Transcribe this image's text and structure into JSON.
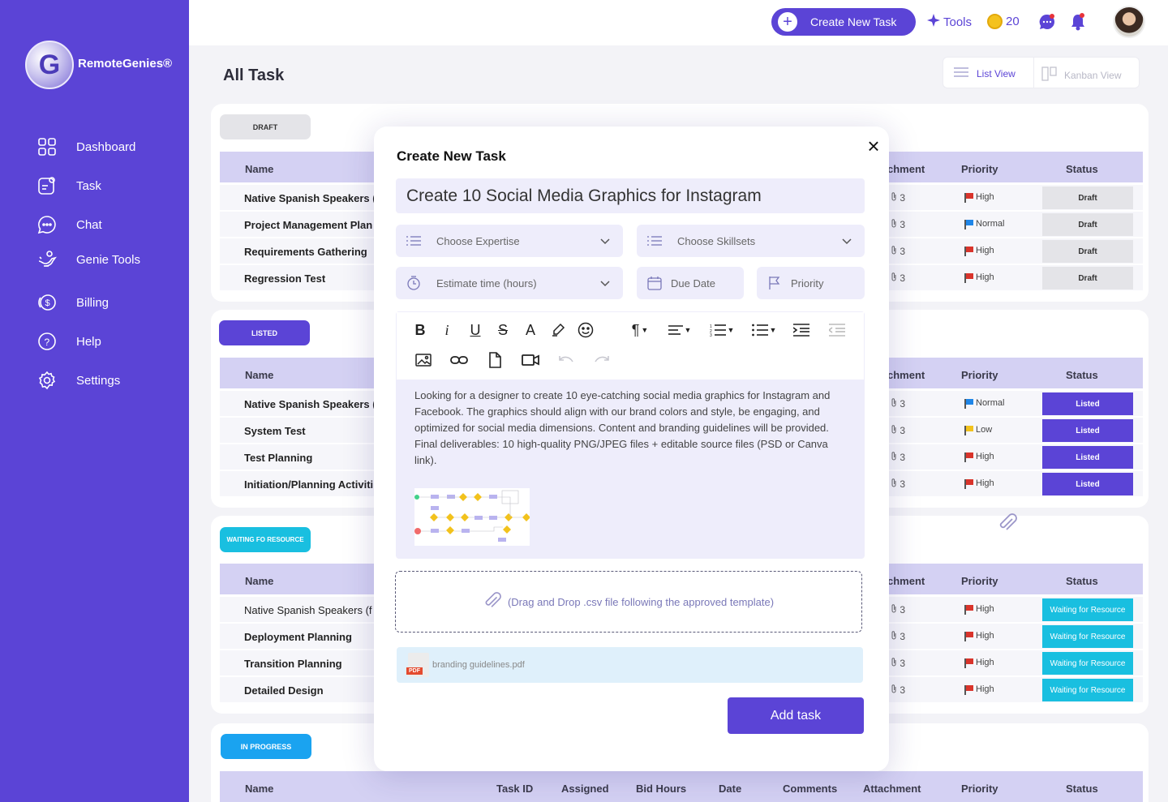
{
  "brand": {
    "name": "RemoteGenies®"
  },
  "sidebar": {
    "items": [
      {
        "label": "Dashboard",
        "icon": "grid-icon"
      },
      {
        "label": "Task",
        "icon": "task-icon"
      },
      {
        "label": "Chat",
        "icon": "chat-icon"
      },
      {
        "label": "Genie Tools",
        "icon": "genie-lamp-icon"
      },
      {
        "label": "Billing",
        "icon": "dollar-icon"
      },
      {
        "label": "Help",
        "icon": "help-icon"
      },
      {
        "label": "Settings",
        "icon": "gear-icon"
      }
    ]
  },
  "topbar": {
    "create_label": "Create New Task",
    "tools_label": "Tools",
    "coins": "20"
  },
  "page": {
    "title": "All Task",
    "list_view": "List View",
    "kanban_view": "Kanban View"
  },
  "columns": {
    "name": "Name",
    "attachment": "chment",
    "priority": "Priority",
    "status": "Status",
    "task_id": "Task ID",
    "assigned": "Assigned",
    "bid_hours": "Bid Hours",
    "date": "Date",
    "comments": "Comments",
    "attachment_full": "Attachment"
  },
  "sections": [
    {
      "badge": "DRAFT",
      "rows": [
        {
          "name": "Native Spanish Speakers (",
          "att": "3",
          "priority": "High",
          "status": "Draft"
        },
        {
          "name": "Project Management Plan",
          "att": "3",
          "priority": "Normal",
          "status": "Draft"
        },
        {
          "name": "Requirements Gathering",
          "att": "3",
          "priority": "High",
          "status": "Draft"
        },
        {
          "name": "Regression Test",
          "att": "3",
          "priority": "High",
          "status": "Draft"
        }
      ]
    },
    {
      "badge": "LISTED",
      "rows": [
        {
          "name": "Native Spanish Speakers (",
          "att": "3",
          "priority": "Normal",
          "status": "Listed"
        },
        {
          "name": "System Test",
          "att": "3",
          "priority": "Low",
          "status": "Listed"
        },
        {
          "name": "Test Planning",
          "att": "3",
          "priority": "High",
          "status": "Listed"
        },
        {
          "name": "Initiation/Planning Activiti",
          "att": "3",
          "priority": "High",
          "status": "Listed"
        }
      ]
    },
    {
      "badge": "WAITING FO RESOURCE",
      "rows": [
        {
          "name": "Native Spanish Speakers (f",
          "att": "3",
          "priority": "High",
          "status": "Waiting for Resource"
        },
        {
          "name": "Deployment Planning",
          "att": "3",
          "priority": "High",
          "status": "Waiting for Resource"
        },
        {
          "name": "Transition Planning",
          "att": "3",
          "priority": "High",
          "status": "Waiting for Resource"
        },
        {
          "name": "Detailed Design",
          "att": "3",
          "priority": "High",
          "status": "Waiting for Resource"
        }
      ]
    },
    {
      "badge": "IN PROGRESS",
      "rows": []
    }
  ],
  "colors": {
    "accent": "#5b44d6",
    "draft_status": "#e4e4e8",
    "listed_status": "#5b44d6",
    "waiting_status": "#19bfe0",
    "inprogress_badge": "#1aa3f0",
    "high": "#d9342b",
    "normal": "#1f86e8",
    "low": "#f2c21c"
  },
  "modal": {
    "title": "Create New Task",
    "task_title": "Create 10 Social Media Graphics for Instagram",
    "expertise": "Choose Expertise",
    "skillsets": "Choose Skillsets",
    "estimate": "Estimate time (hours)",
    "due_date": "Due Date",
    "priority": "Priority",
    "description": "Looking for a designer to create 10 eye-catching social media graphics for Instagram and Facebook. The graphics should align with our brand colors and style, be engaging, and optimized for social media dimensions. Content and branding guidelines will be provided. Final deliverables: 10 high-quality PNG/JPEG files + editable source files (PSD or Canva link).",
    "drop_text": "(Drag and Drop .csv file following the approved template)",
    "file_name": "branding guidelines.pdf",
    "file_badge": "PDF",
    "add_label": "Add task"
  }
}
